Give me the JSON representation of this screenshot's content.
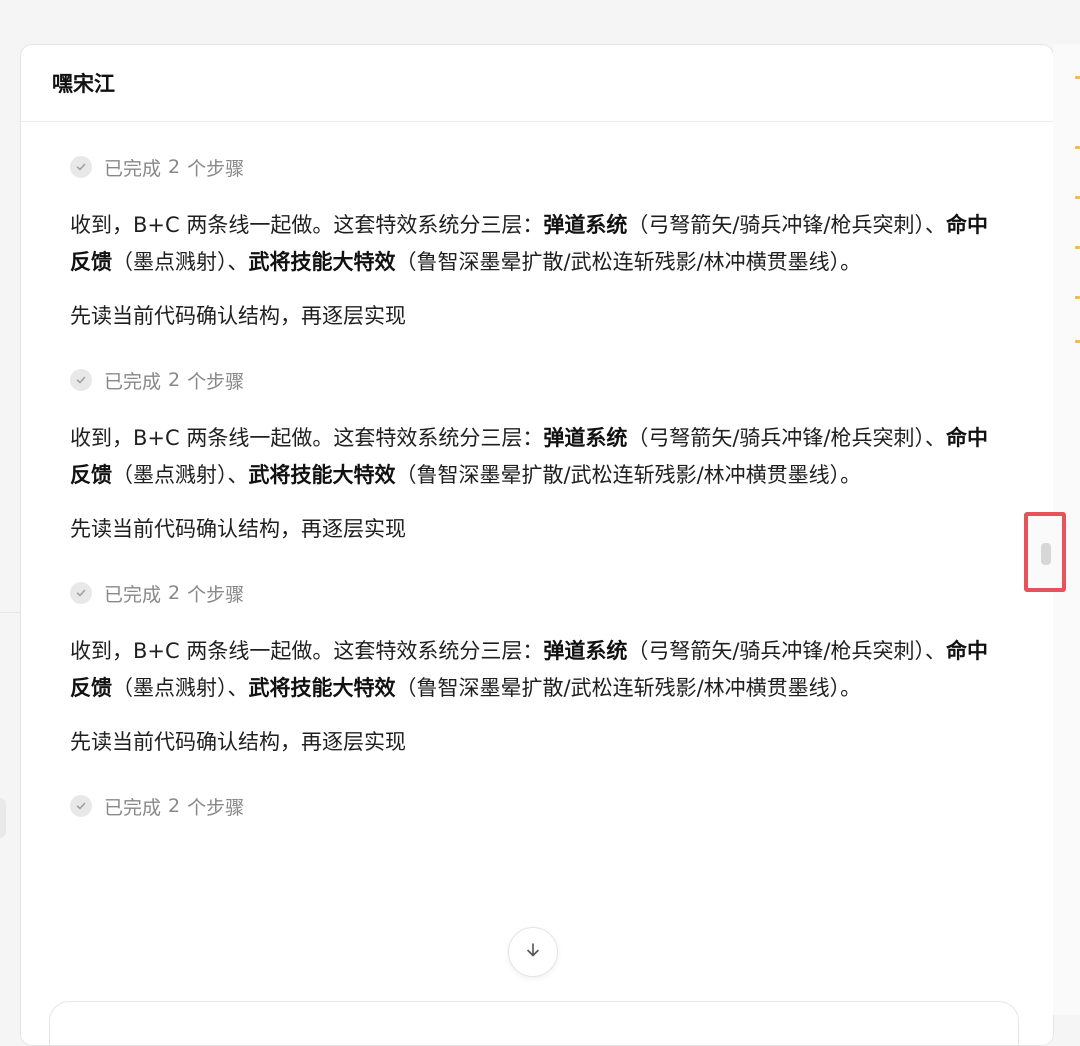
{
  "header": {
    "title": "嘿宋江"
  },
  "messages": [
    {
      "step_prefix": "已完成",
      "step_count": "2",
      "step_suffix": "个步骤",
      "intro": "收到，B+C 两条线一起做。这套特效系统分三层：",
      "layer1_title": "弹道系统",
      "layer1_desc": "（弓弩箭矢/骑兵冲锋/枪兵突刺）、",
      "layer2_title": "命中反馈",
      "layer2_desc": "（墨点溅射）、",
      "layer3_title": "武将技能大特效",
      "layer3_desc": "（鲁智深墨晕扩散/武松连斩残影/林冲横贯墨线）。",
      "followup": "先读当前代码确认结构，再逐层实现"
    },
    {
      "step_prefix": "已完成",
      "step_count": "2",
      "step_suffix": "个步骤",
      "intro": "收到，B+C 两条线一起做。这套特效系统分三层：",
      "layer1_title": "弹道系统",
      "layer1_desc": "（弓弩箭矢/骑兵冲锋/枪兵突刺）、",
      "layer2_title": "命中反馈",
      "layer2_desc": "（墨点溅射）、",
      "layer3_title": "武将技能大特效",
      "layer3_desc": "（鲁智深墨晕扩散/武松连斩残影/林冲横贯墨线）。",
      "followup": "先读当前代码确认结构，再逐层实现"
    },
    {
      "step_prefix": "已完成",
      "step_count": "2",
      "step_suffix": "个步骤",
      "intro": "收到，B+C 两条线一起做。这套特效系统分三层：",
      "layer1_title": "弹道系统",
      "layer1_desc": "（弓弩箭矢/骑兵冲锋/枪兵突刺）、",
      "layer2_title": "命中反馈",
      "layer2_desc": "（墨点溅射）、",
      "layer3_title": "武将技能大特效",
      "layer3_desc": "（鲁智深墨晕扩散/武松连斩残影/林冲横贯墨线）。",
      "followup": "先读当前代码确认结构，再逐层实现"
    },
    {
      "step_prefix": "已完成",
      "step_count": "2",
      "step_suffix": "个步骤"
    }
  ],
  "icons": {
    "check": "check-icon",
    "scroll_down": "arrow-down-icon"
  },
  "colors": {
    "highlight": "#e8525b",
    "accent": "#f2b84a"
  }
}
